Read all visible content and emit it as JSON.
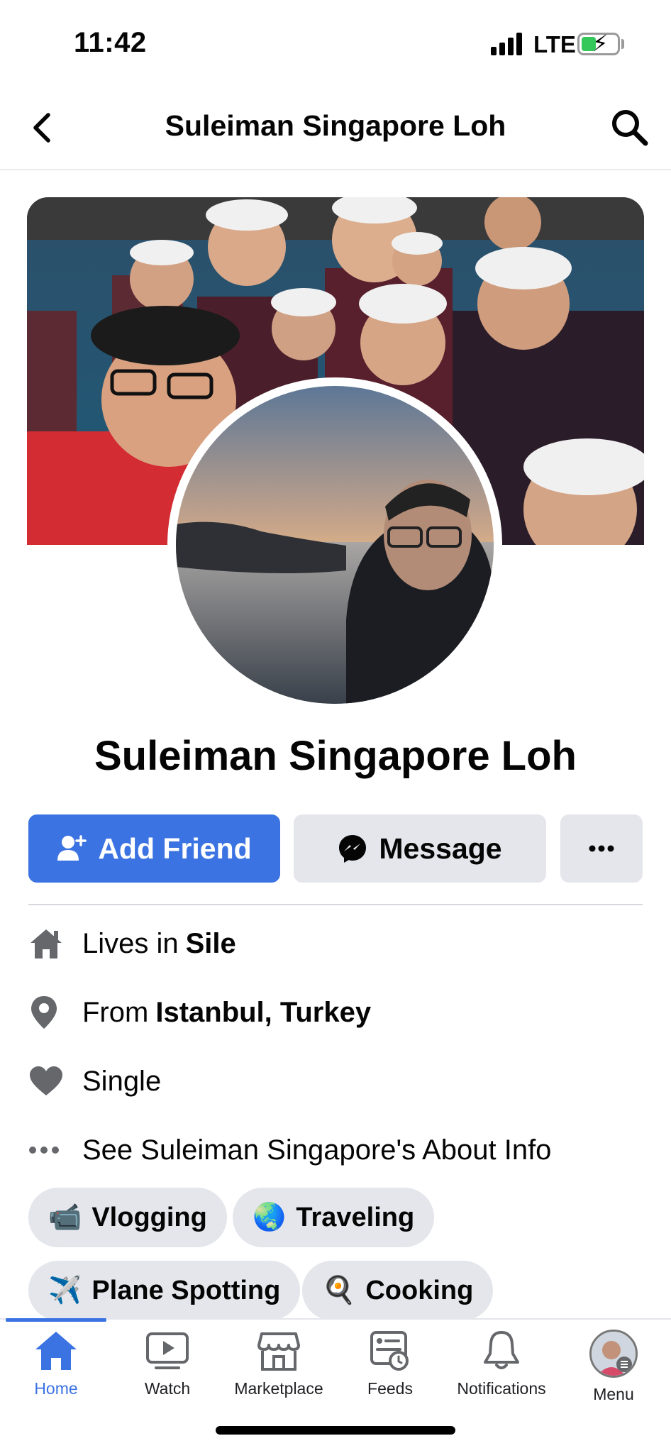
{
  "status_bar": {
    "time": "11:42",
    "network": "LTE"
  },
  "header": {
    "title": "Suleiman Singapore Loh"
  },
  "profile": {
    "name": "Suleiman Singapore Loh"
  },
  "actions": {
    "add_friend": "Add Friend",
    "message": "Message"
  },
  "info": {
    "lives_prefix": "Lives in",
    "lives_value": "Sile",
    "from_prefix": "From",
    "from_value": "Istanbul, Turkey",
    "relationship": "Single",
    "about_link": "See Suleiman Singapore's About Info"
  },
  "interests": [
    {
      "emoji": "📹",
      "label": "Vlogging"
    },
    {
      "emoji": "🌏",
      "label": "Traveling"
    },
    {
      "emoji": "✈️",
      "label": "Plane Spotting"
    },
    {
      "emoji": "🍳",
      "label": "Cooking"
    }
  ],
  "tabs": [
    {
      "label": "Home",
      "icon": "home-icon",
      "active": true
    },
    {
      "label": "Watch",
      "icon": "watch-icon"
    },
    {
      "label": "Marketplace",
      "icon": "marketplace-icon"
    },
    {
      "label": "Feeds",
      "icon": "feeds-icon"
    },
    {
      "label": "Notifications",
      "icon": "bell-icon"
    },
    {
      "label": "Menu",
      "icon": "avatar"
    }
  ],
  "colors": {
    "accent": "#3b73e2",
    "button_gray": "#e4e6eb",
    "icon_gray": "#65676b"
  }
}
